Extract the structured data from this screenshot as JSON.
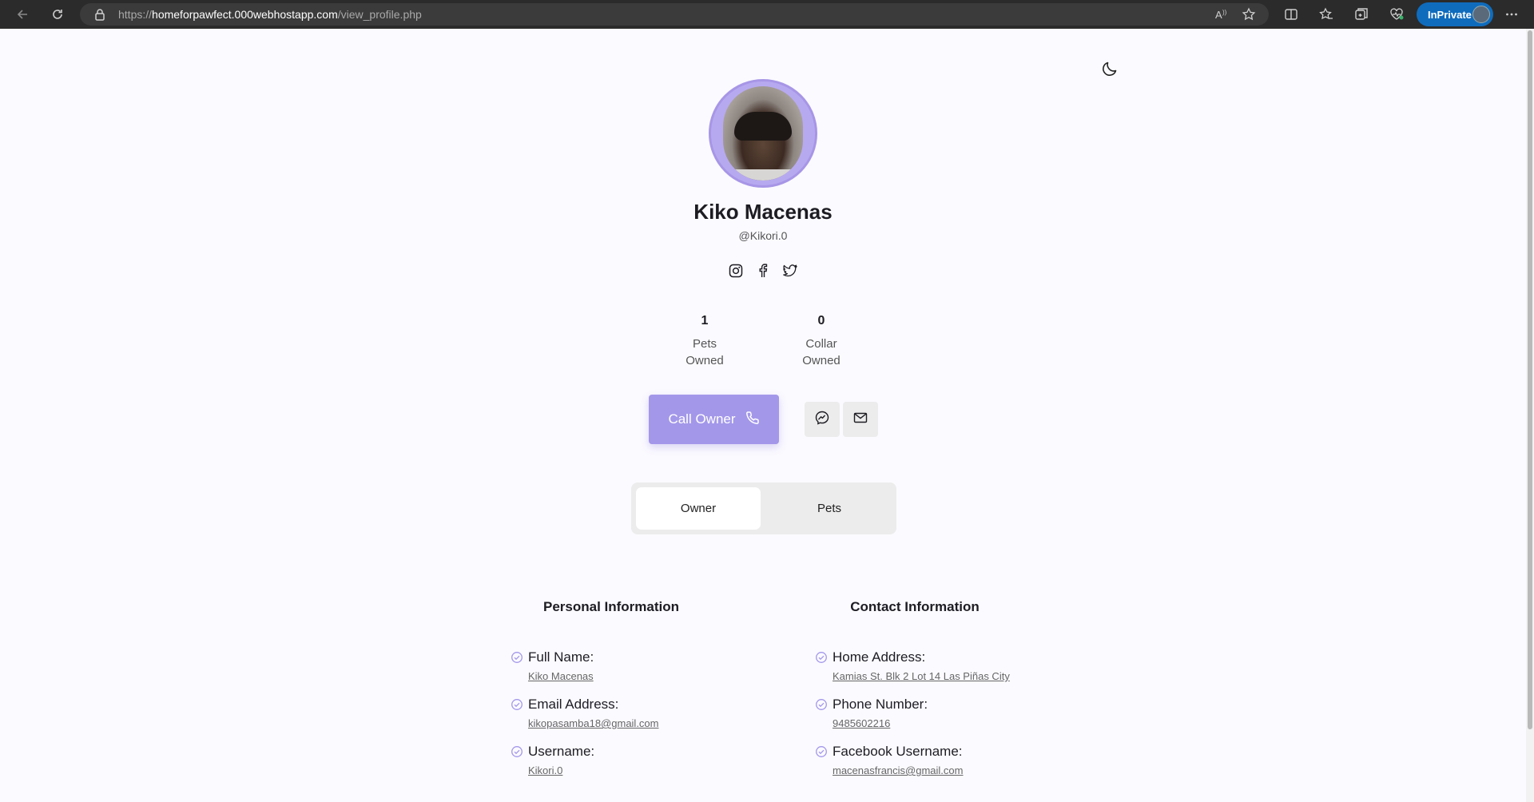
{
  "browser": {
    "url_scheme": "https://",
    "url_host": "homeforpawfect.000webhostapp.com",
    "url_path": "/view_profile.php",
    "inprivate_label": "InPrivate"
  },
  "profile": {
    "name": "Kiko Macenas",
    "handle": "@Kikori.0"
  },
  "stats": [
    {
      "value": "1",
      "line1": "Pets",
      "line2": "Owned"
    },
    {
      "value": "0",
      "line1": "Collar",
      "line2": "Owned"
    }
  ],
  "actions": {
    "call_label": "Call Owner"
  },
  "tabs": [
    {
      "label": "Owner",
      "active": true
    },
    {
      "label": "Pets",
      "active": false
    }
  ],
  "personal": {
    "title": "Personal Information",
    "items": [
      {
        "label": "Full Name:",
        "value": "Kiko Macenas"
      },
      {
        "label": "Email Address:",
        "value": "kikopasamba18@gmail.com"
      },
      {
        "label": "Username:",
        "value": "Kikori.0"
      }
    ]
  },
  "contact": {
    "title": "Contact Information",
    "items": [
      {
        "label": "Home Address:",
        "value": "Kamias St. Blk 2 Lot 14 Las Piñas City"
      },
      {
        "label": "Phone Number:",
        "value": "9485602216"
      },
      {
        "label": "Facebook Username:",
        "value": "macenasfrancis@gmail.com"
      }
    ]
  },
  "colors": {
    "accent": "#a397ea",
    "accent_ring": "#a796e6",
    "background": "#fbfaff"
  },
  "icons": {
    "socials": [
      "instagram-icon",
      "facebook-icon",
      "twitter-icon"
    ],
    "secondary_actions": [
      "messenger-icon",
      "mail-icon"
    ]
  }
}
